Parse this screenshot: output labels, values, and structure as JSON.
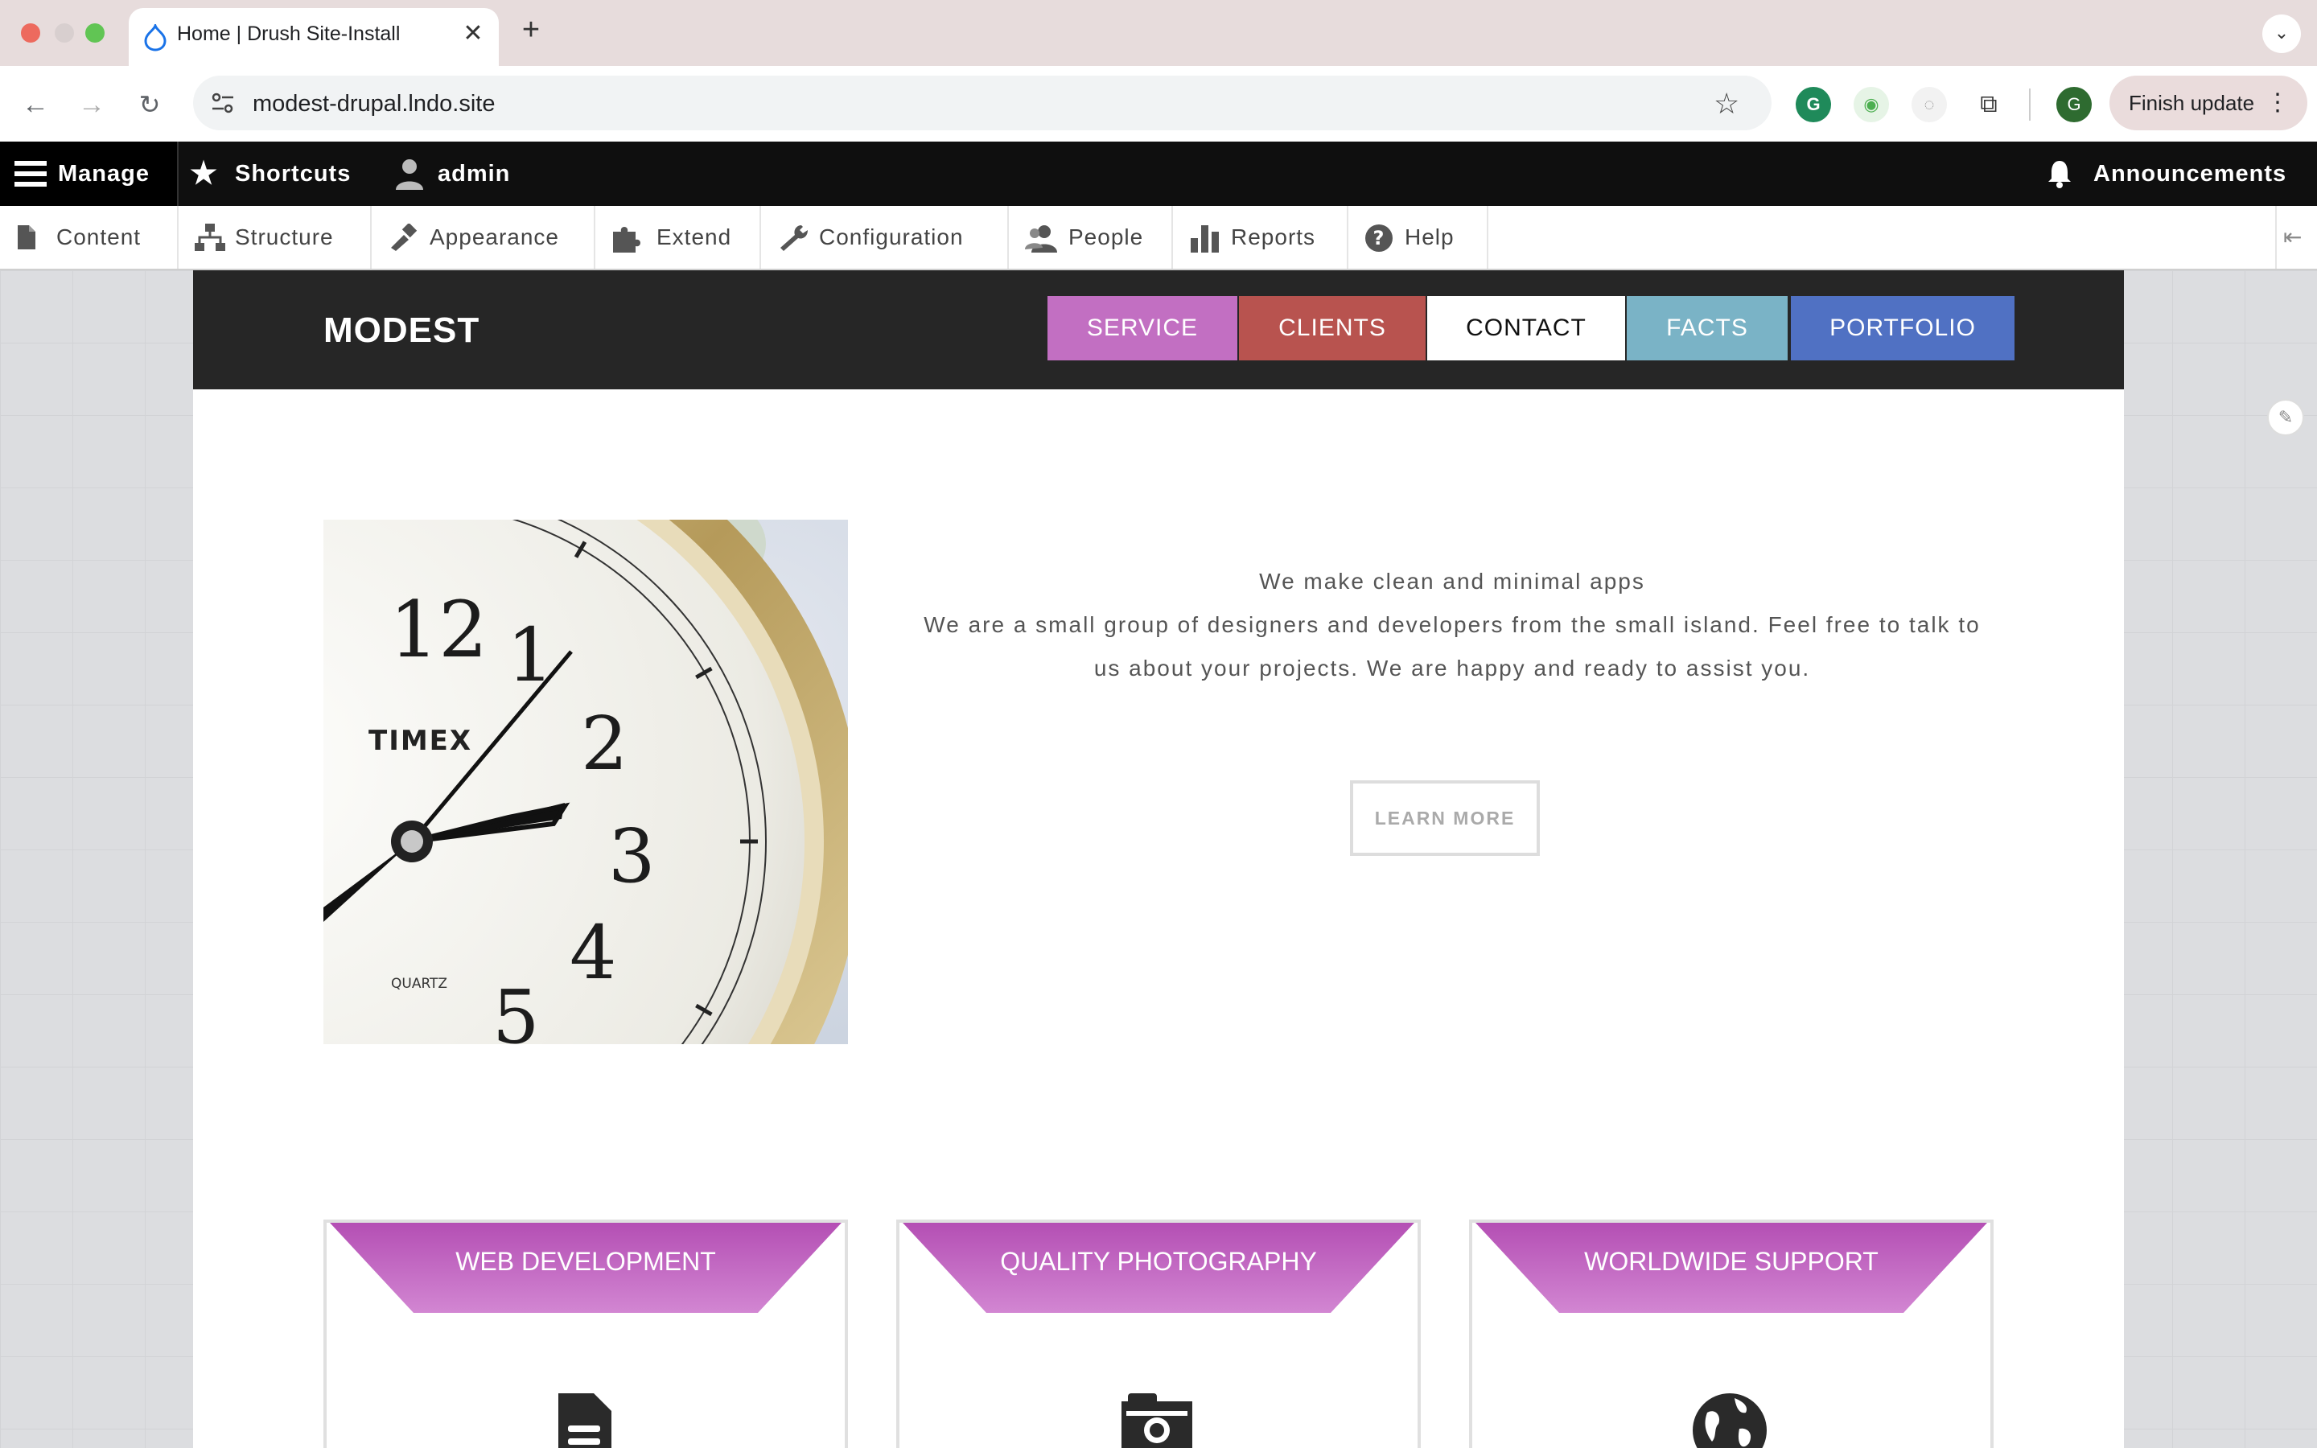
{
  "browser": {
    "tab_title": "Home | Drush Site-Install",
    "url": "modest-drupal.lndo.site",
    "finish_update": "Finish update",
    "profile_initial": "G"
  },
  "admin_toolbar": {
    "manage": "Manage",
    "shortcuts": "Shortcuts",
    "user": "admin",
    "announcements": "Announcements"
  },
  "admin_tray": {
    "items": [
      {
        "label": "Content",
        "icon": "file-icon"
      },
      {
        "label": "Structure",
        "icon": "sitemap-icon"
      },
      {
        "label": "Appearance",
        "icon": "paintbrush-icon"
      },
      {
        "label": "Extend",
        "icon": "puzzle-icon"
      },
      {
        "label": "Configuration",
        "icon": "wrench-icon"
      },
      {
        "label": "People",
        "icon": "people-icon"
      },
      {
        "label": "Reports",
        "icon": "bar-chart-icon"
      },
      {
        "label": "Help",
        "icon": "help-icon"
      }
    ]
  },
  "site": {
    "logo": "MODEST",
    "menu": [
      {
        "label": "SERVICE",
        "color": "#c26fc2"
      },
      {
        "label": "CLIENTS",
        "color": "#b8534f"
      },
      {
        "label": "CONTACT",
        "color": "#ffffff"
      },
      {
        "label": "FACTS",
        "color": "#7ab3c6"
      },
      {
        "label": "PORTFOLIO",
        "color": "#5071c3"
      }
    ]
  },
  "intro": {
    "heading": "We make clean and minimal apps",
    "body_line1": "We are a small group of designers and developers from the small island. Feel free to talk to",
    "body_line2": "us about your projects. We are happy and ready to assist you.",
    "button": "LEARN MORE"
  },
  "clock_image": {
    "brand": "TIMEX",
    "sub": "QUARTZ",
    "numerals": [
      "12",
      "1",
      "2",
      "3",
      "4",
      "5"
    ]
  },
  "features": [
    {
      "title": "WEB DEVELOPMENT",
      "icon": "document-icon"
    },
    {
      "title": "QUALITY PHOTOGRAPHY",
      "icon": "camera-icon"
    },
    {
      "title": "WORLDWIDE SUPPORT",
      "icon": "globe-icon"
    }
  ]
}
